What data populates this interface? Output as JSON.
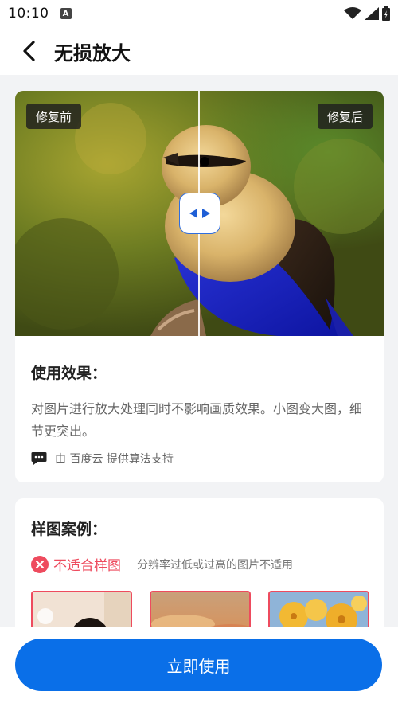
{
  "status_bar": {
    "time": "10:10",
    "notification_glyph": "A",
    "icons": [
      "wifi-icon",
      "signal-icon",
      "battery-icon"
    ]
  },
  "header": {
    "title": "无损放大"
  },
  "preview": {
    "before_label": "修复前",
    "after_label": "修复后"
  },
  "effect": {
    "heading": "使用效果：",
    "description": "对图片进行放大处理同时不影响画质效果。小图变大图，细节更突出。",
    "provider": "由 百度云 提供算法支持"
  },
  "samples": {
    "heading": "样图案例：",
    "unsuitable_label": "不适合样图",
    "unsuitable_desc": "分辨率过低或过高的图片不适用"
  },
  "cta": {
    "label": "立即使用"
  },
  "colors": {
    "accent": "#0a6fe8",
    "warning": "#ee4b5e"
  }
}
